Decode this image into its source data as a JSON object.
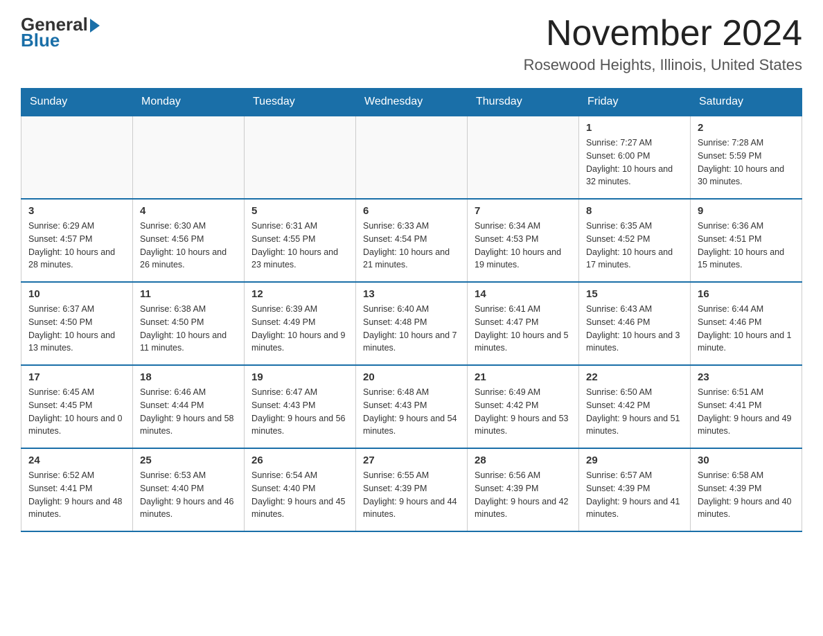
{
  "logo": {
    "general": "General",
    "blue": "Blue"
  },
  "header": {
    "month": "November 2024",
    "location": "Rosewood Heights, Illinois, United States"
  },
  "weekdays": [
    "Sunday",
    "Monday",
    "Tuesday",
    "Wednesday",
    "Thursday",
    "Friday",
    "Saturday"
  ],
  "weeks": [
    [
      {
        "day": "",
        "info": ""
      },
      {
        "day": "",
        "info": ""
      },
      {
        "day": "",
        "info": ""
      },
      {
        "day": "",
        "info": ""
      },
      {
        "day": "",
        "info": ""
      },
      {
        "day": "1",
        "info": "Sunrise: 7:27 AM\nSunset: 6:00 PM\nDaylight: 10 hours and 32 minutes."
      },
      {
        "day": "2",
        "info": "Sunrise: 7:28 AM\nSunset: 5:59 PM\nDaylight: 10 hours and 30 minutes."
      }
    ],
    [
      {
        "day": "3",
        "info": "Sunrise: 6:29 AM\nSunset: 4:57 PM\nDaylight: 10 hours and 28 minutes."
      },
      {
        "day": "4",
        "info": "Sunrise: 6:30 AM\nSunset: 4:56 PM\nDaylight: 10 hours and 26 minutes."
      },
      {
        "day": "5",
        "info": "Sunrise: 6:31 AM\nSunset: 4:55 PM\nDaylight: 10 hours and 23 minutes."
      },
      {
        "day": "6",
        "info": "Sunrise: 6:33 AM\nSunset: 4:54 PM\nDaylight: 10 hours and 21 minutes."
      },
      {
        "day": "7",
        "info": "Sunrise: 6:34 AM\nSunset: 4:53 PM\nDaylight: 10 hours and 19 minutes."
      },
      {
        "day": "8",
        "info": "Sunrise: 6:35 AM\nSunset: 4:52 PM\nDaylight: 10 hours and 17 minutes."
      },
      {
        "day": "9",
        "info": "Sunrise: 6:36 AM\nSunset: 4:51 PM\nDaylight: 10 hours and 15 minutes."
      }
    ],
    [
      {
        "day": "10",
        "info": "Sunrise: 6:37 AM\nSunset: 4:50 PM\nDaylight: 10 hours and 13 minutes."
      },
      {
        "day": "11",
        "info": "Sunrise: 6:38 AM\nSunset: 4:50 PM\nDaylight: 10 hours and 11 minutes."
      },
      {
        "day": "12",
        "info": "Sunrise: 6:39 AM\nSunset: 4:49 PM\nDaylight: 10 hours and 9 minutes."
      },
      {
        "day": "13",
        "info": "Sunrise: 6:40 AM\nSunset: 4:48 PM\nDaylight: 10 hours and 7 minutes."
      },
      {
        "day": "14",
        "info": "Sunrise: 6:41 AM\nSunset: 4:47 PM\nDaylight: 10 hours and 5 minutes."
      },
      {
        "day": "15",
        "info": "Sunrise: 6:43 AM\nSunset: 4:46 PM\nDaylight: 10 hours and 3 minutes."
      },
      {
        "day": "16",
        "info": "Sunrise: 6:44 AM\nSunset: 4:46 PM\nDaylight: 10 hours and 1 minute."
      }
    ],
    [
      {
        "day": "17",
        "info": "Sunrise: 6:45 AM\nSunset: 4:45 PM\nDaylight: 10 hours and 0 minutes."
      },
      {
        "day": "18",
        "info": "Sunrise: 6:46 AM\nSunset: 4:44 PM\nDaylight: 9 hours and 58 minutes."
      },
      {
        "day": "19",
        "info": "Sunrise: 6:47 AM\nSunset: 4:43 PM\nDaylight: 9 hours and 56 minutes."
      },
      {
        "day": "20",
        "info": "Sunrise: 6:48 AM\nSunset: 4:43 PM\nDaylight: 9 hours and 54 minutes."
      },
      {
        "day": "21",
        "info": "Sunrise: 6:49 AM\nSunset: 4:42 PM\nDaylight: 9 hours and 53 minutes."
      },
      {
        "day": "22",
        "info": "Sunrise: 6:50 AM\nSunset: 4:42 PM\nDaylight: 9 hours and 51 minutes."
      },
      {
        "day": "23",
        "info": "Sunrise: 6:51 AM\nSunset: 4:41 PM\nDaylight: 9 hours and 49 minutes."
      }
    ],
    [
      {
        "day": "24",
        "info": "Sunrise: 6:52 AM\nSunset: 4:41 PM\nDaylight: 9 hours and 48 minutes."
      },
      {
        "day": "25",
        "info": "Sunrise: 6:53 AM\nSunset: 4:40 PM\nDaylight: 9 hours and 46 minutes."
      },
      {
        "day": "26",
        "info": "Sunrise: 6:54 AM\nSunset: 4:40 PM\nDaylight: 9 hours and 45 minutes."
      },
      {
        "day": "27",
        "info": "Sunrise: 6:55 AM\nSunset: 4:39 PM\nDaylight: 9 hours and 44 minutes."
      },
      {
        "day": "28",
        "info": "Sunrise: 6:56 AM\nSunset: 4:39 PM\nDaylight: 9 hours and 42 minutes."
      },
      {
        "day": "29",
        "info": "Sunrise: 6:57 AM\nSunset: 4:39 PM\nDaylight: 9 hours and 41 minutes."
      },
      {
        "day": "30",
        "info": "Sunrise: 6:58 AM\nSunset: 4:39 PM\nDaylight: 9 hours and 40 minutes."
      }
    ]
  ]
}
